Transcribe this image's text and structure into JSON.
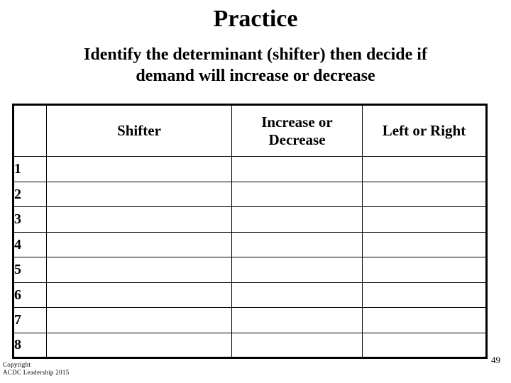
{
  "slide": {
    "title": "Practice",
    "subtitle_lines": [
      "Identify the determinant (shifter) then decide if",
      "demand will increase or decrease"
    ],
    "page_number": "49"
  },
  "table": {
    "headers": {
      "col_number": "",
      "col_shifter": "Shifter",
      "col_increase_decrease": "Increase or Decrease",
      "col_increase_decrease_line1": "Increase or",
      "col_increase_decrease_line2": "Decrease",
      "col_left_right": "Left or Right"
    },
    "rows": [
      {
        "number": "1",
        "shifter": "",
        "increase_or_decrease": "",
        "left_or_right": ""
      },
      {
        "number": "2",
        "shifter": "",
        "increase_or_decrease": "",
        "left_or_right": ""
      },
      {
        "number": "3",
        "shifter": "",
        "increase_or_decrease": "",
        "left_or_right": ""
      },
      {
        "number": "4",
        "shifter": "",
        "increase_or_decrease": "",
        "left_or_right": ""
      },
      {
        "number": "5",
        "shifter": "",
        "increase_or_decrease": "",
        "left_or_right": ""
      },
      {
        "number": "6",
        "shifter": "",
        "increase_or_decrease": "",
        "left_or_right": ""
      },
      {
        "number": "7",
        "shifter": "",
        "increase_or_decrease": "",
        "left_or_right": ""
      },
      {
        "number": "8",
        "shifter": "",
        "increase_or_decrease": "",
        "left_or_right": ""
      }
    ]
  },
  "footer": {
    "copyright_line1": "Copyright",
    "copyright_line2": "ACDC Leadership 2015"
  },
  "colors": {
    "background": "#ffffff",
    "text": "#000000",
    "table_border": "#000000"
  }
}
